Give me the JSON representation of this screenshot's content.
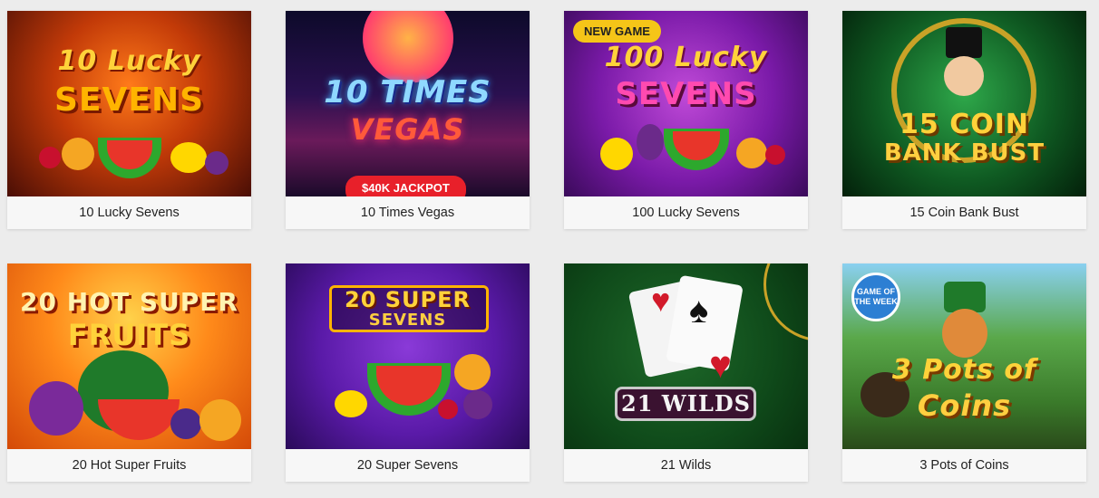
{
  "games": [
    {
      "title": "10 Lucky Sevens",
      "logo_line1": "10 Lucky",
      "logo_line2": "SEVENS"
    },
    {
      "title": "10 Times Vegas",
      "logo_line1": "10 TIMES",
      "logo_line2": "VEGAS",
      "badge": "$40K JACKPOT"
    },
    {
      "title": "100 Lucky Sevens",
      "logo_line1": "100 Lucky",
      "logo_line2": "SEVENS",
      "badge": "NEW GAME"
    },
    {
      "title": "15 Coin Bank Bust",
      "logo_line1": "15 COIN",
      "logo_line2": "BANK BUST"
    },
    {
      "title": "20 Hot Super Fruits",
      "logo_line1": "20 HOT SUPER",
      "logo_line2": "FRUITS"
    },
    {
      "title": "20 Super Sevens",
      "logo_line1": "20 SUPER",
      "logo_line2": "SEVENS"
    },
    {
      "title": "21 Wilds",
      "logo_line1": "21 WILDS"
    },
    {
      "title": "3 Pots of Coins",
      "logo_line1": "3 Pots of",
      "logo_line2": "Coins",
      "badge": "GAME OF THE WEEK"
    }
  ],
  "colors": {
    "page_bg": "#ececec",
    "card_bg": "#f7f7f7",
    "new_badge": "#f5c518",
    "jackpot_badge": "#e8202a",
    "gotw_badge": "#2d7fd3"
  }
}
